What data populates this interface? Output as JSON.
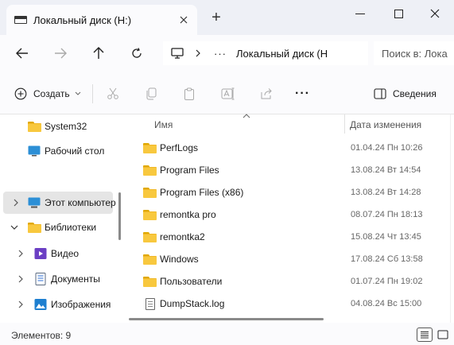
{
  "window": {
    "tab_title": "Локальный диск (H:)",
    "new_tab_label": "+"
  },
  "address_bar": {
    "path_text": "Локальный диск (H",
    "more_label": "···",
    "search_placeholder": "Поиск в: Лока"
  },
  "command_bar": {
    "create_label": "Создать",
    "details_label": "Сведения",
    "more_label": "···"
  },
  "nav_pane": {
    "items": [
      {
        "label": "System32",
        "icon": "folder-icon"
      },
      {
        "label": "Рабочий стол",
        "icon": "desktop-icon"
      },
      {
        "label": "Этот компьютер",
        "icon": "computer-icon",
        "selected": true
      },
      {
        "label": "Библиотеки",
        "icon": "library-icon",
        "expanded": true
      },
      {
        "label": "Видео",
        "icon": "video-icon"
      },
      {
        "label": "Документы",
        "icon": "documents-icon"
      },
      {
        "label": "Изображения",
        "icon": "images-icon"
      }
    ]
  },
  "file_list": {
    "columns": {
      "name": "Имя",
      "date": "Дата изменения"
    },
    "rows": [
      {
        "name": "PerfLogs",
        "date": "01.04.24 Пн 10:26",
        "type": "folder"
      },
      {
        "name": "Program Files",
        "date": "13.08.24 Вт 14:54",
        "type": "folder"
      },
      {
        "name": "Program Files (x86)",
        "date": "13.08.24 Вт 14:28",
        "type": "folder"
      },
      {
        "name": "remontka pro",
        "date": "08.07.24 Пн 18:13",
        "type": "folder"
      },
      {
        "name": "remontka2",
        "date": "15.08.24 Чт 13:45",
        "type": "folder"
      },
      {
        "name": "Windows",
        "date": "17.08.24 Сб 13:58",
        "type": "folder"
      },
      {
        "name": "Пользователи",
        "date": "01.07.24 Пн 19:02",
        "type": "folder"
      },
      {
        "name": "DumpStack.log",
        "date": "04.08.24 Вс 15:00",
        "type": "file"
      }
    ]
  },
  "status_bar": {
    "items_count": "Элементов: 9"
  },
  "colors": {
    "titlebar_bg": "#eef0f6",
    "folder_yellow": "#f8c83e",
    "selection_bg": "#e5e5e5"
  }
}
